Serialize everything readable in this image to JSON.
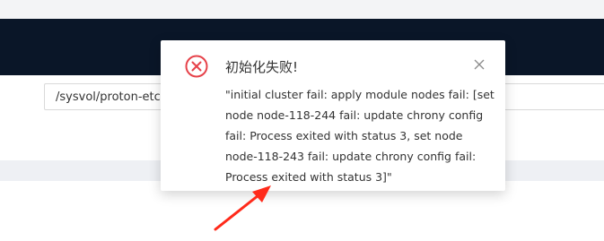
{
  "path_field": {
    "value": "/sysvol/proton-etcd"
  },
  "notification": {
    "title": "初始化失败!",
    "message": "\"initial cluster fail: apply module nodes fail: [set node node-118-244 fail: update chrony config fail: Process exited with status 3, set node node-118-243 fail: update chrony config fail: Process exited with status 3]\""
  },
  "colors": {
    "header": "#0a1628",
    "error_icon": "#e6424a",
    "annotation_arrow": "#ff2a1a",
    "page_band": "#eef0f4"
  },
  "icons": {
    "error": "close-circle-icon",
    "close": "close-icon",
    "annotation": "red-arrow-icon"
  }
}
